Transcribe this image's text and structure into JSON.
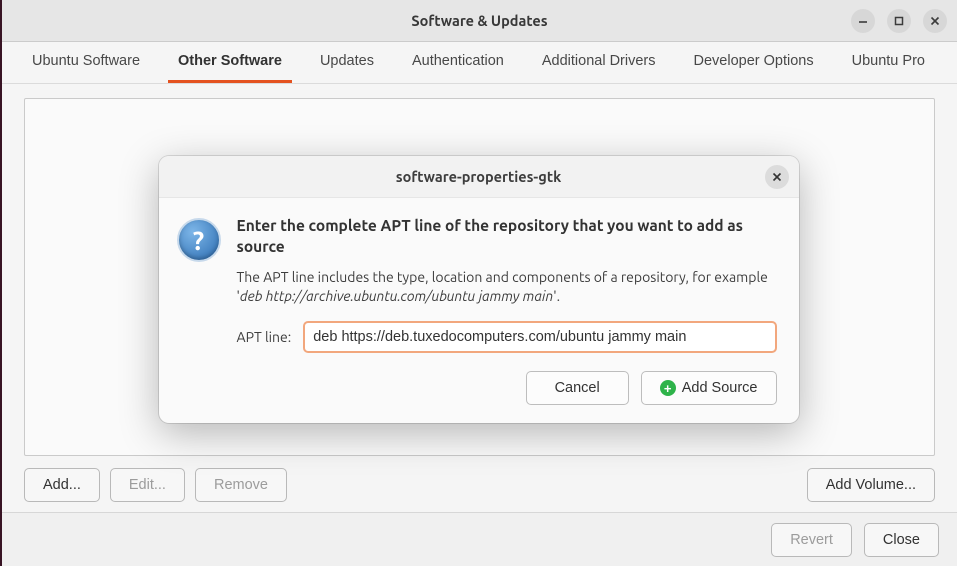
{
  "window": {
    "title": "Software & Updates"
  },
  "tabs": [
    {
      "label": "Ubuntu Software"
    },
    {
      "label": "Other Software"
    },
    {
      "label": "Updates"
    },
    {
      "label": "Authentication"
    },
    {
      "label": "Additional Drivers"
    },
    {
      "label": "Developer Options"
    },
    {
      "label": "Ubuntu Pro"
    }
  ],
  "active_tab_index": 1,
  "buttons": {
    "add": "Add...",
    "edit": "Edit...",
    "remove": "Remove",
    "add_volume": "Add Volume...",
    "revert": "Revert",
    "close": "Close"
  },
  "dialog": {
    "title": "software-properties-gtk",
    "heading": "Enter the complete APT line of the repository that you want to add as source",
    "sub_pre": "The APT line includes the type, location and components of a repository, for example  '",
    "sub_example": "deb http://archive.ubuntu.com/ubuntu jammy main",
    "sub_post": "'.",
    "apt_label": "APT line:",
    "apt_value": "deb https://deb.tuxedocomputers.com/ubuntu jammy main",
    "cancel": "Cancel",
    "add_source": "Add Source"
  }
}
